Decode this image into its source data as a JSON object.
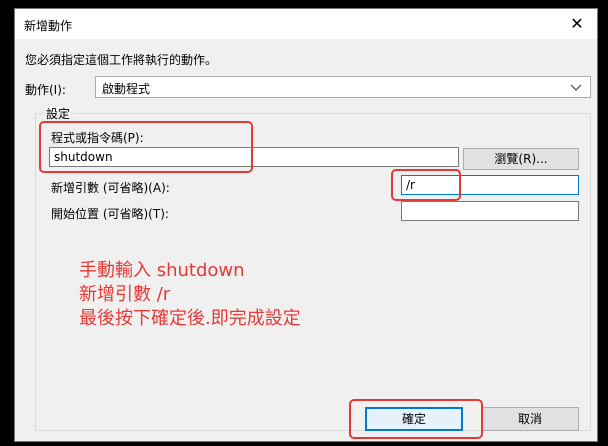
{
  "window": {
    "title": "新增動作",
    "close_symbol": "✕"
  },
  "instruction": "您必須指定這個工作將執行的動作。",
  "action": {
    "label": "動作(I):",
    "value": "啟動程式"
  },
  "settings": {
    "legend": "設定",
    "program_label": "程式或指令碼(P):",
    "program_value": "shutdown",
    "browse_label": "瀏覽(R)...",
    "args_label": "新增引數 (可省略)(A):",
    "args_value": "/r",
    "start_label": "開始位置 (可省略)(T):",
    "start_value": ""
  },
  "annotations": [
    "手動輸入 shutdown",
    "新增引數 /r",
    "最後按下確定後.即完成設定"
  ],
  "buttons": {
    "ok": "確定",
    "cancel": "取消"
  },
  "colors": {
    "highlight": "#e53935",
    "annotation_text": "#e53935",
    "focus_border": "#0078d7"
  }
}
